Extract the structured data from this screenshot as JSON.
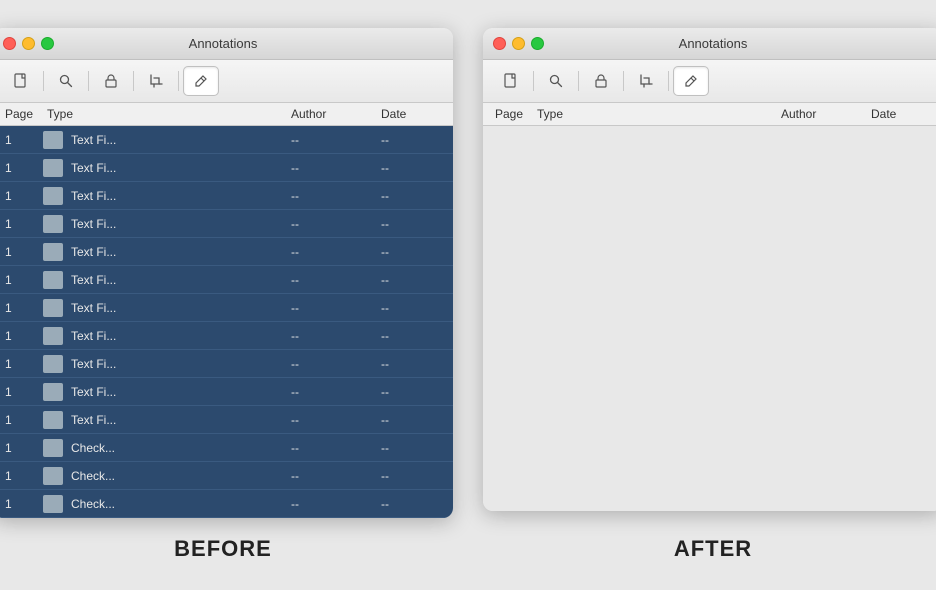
{
  "windows": {
    "before": {
      "title": "Annotations",
      "label": "BEFORE",
      "traffic_lights": [
        "red",
        "yellow",
        "green"
      ],
      "toolbar_buttons": [
        {
          "icon": "📄",
          "name": "new",
          "active": false
        },
        {
          "icon": "🔍",
          "name": "search",
          "active": false
        },
        {
          "icon": "🔒",
          "name": "lock",
          "active": false
        },
        {
          "icon": "✂️",
          "name": "crop",
          "active": false
        },
        {
          "icon": "✏️",
          "name": "edit",
          "active": true
        }
      ],
      "columns": [
        "Page",
        "Type",
        "Author",
        "Date"
      ],
      "rows": [
        {
          "page": "1",
          "type": "Text Fi...",
          "author": "--",
          "date": "--"
        },
        {
          "page": "1",
          "type": "Text Fi...",
          "author": "--",
          "date": "--"
        },
        {
          "page": "1",
          "type": "Text Fi...",
          "author": "--",
          "date": "--"
        },
        {
          "page": "1",
          "type": "Text Fi...",
          "author": "--",
          "date": "--"
        },
        {
          "page": "1",
          "type": "Text Fi...",
          "author": "--",
          "date": "--"
        },
        {
          "page": "1",
          "type": "Text Fi...",
          "author": "--",
          "date": "--"
        },
        {
          "page": "1",
          "type": "Text Fi...",
          "author": "--",
          "date": "--"
        },
        {
          "page": "1",
          "type": "Text Fi...",
          "author": "--",
          "date": "--"
        },
        {
          "page": "1",
          "type": "Text Fi...",
          "author": "--",
          "date": "--"
        },
        {
          "page": "1",
          "type": "Text Fi...",
          "author": "--",
          "date": "--"
        },
        {
          "page": "1",
          "type": "Text Fi...",
          "author": "--",
          "date": "--"
        },
        {
          "page": "1",
          "type": "Check...",
          "author": "--",
          "date": "--"
        },
        {
          "page": "1",
          "type": "Check...",
          "author": "--",
          "date": "--"
        },
        {
          "page": "1",
          "type": "Check...",
          "author": "--",
          "date": "--"
        }
      ]
    },
    "after": {
      "title": "Annotations",
      "label": "AFTER",
      "traffic_lights": [
        "red",
        "yellow",
        "green"
      ],
      "toolbar_buttons": [
        {
          "icon": "📄",
          "name": "new",
          "active": false
        },
        {
          "icon": "🔍",
          "name": "search",
          "active": false
        },
        {
          "icon": "🔒",
          "name": "lock",
          "active": false
        },
        {
          "icon": "✂️",
          "name": "crop",
          "active": false
        },
        {
          "icon": "✏️",
          "name": "edit",
          "active": true
        }
      ],
      "columns": [
        "Page",
        "Type",
        "Author",
        "Date"
      ],
      "rows": []
    }
  }
}
